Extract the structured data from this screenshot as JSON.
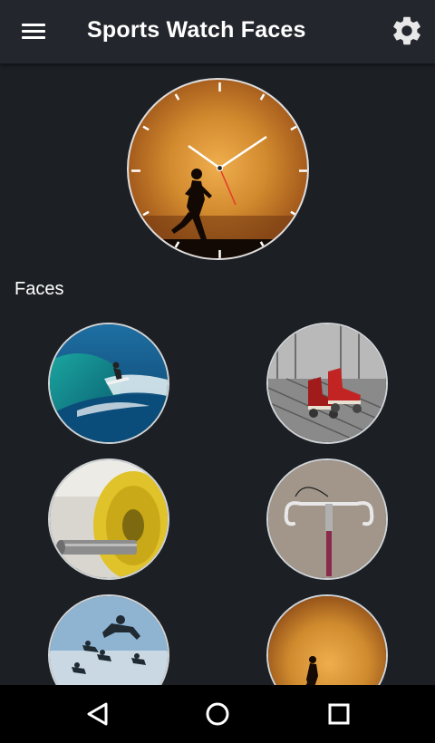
{
  "app": {
    "title": "Sports Watch Faces",
    "menu_icon": "hamburger-menu-icon",
    "settings_icon": "gear-icon"
  },
  "preview": {
    "description_icon": "watch-face-runner-sunset-preview"
  },
  "faces_section": {
    "label": "Faces",
    "items": [
      {
        "name": "surfer-face",
        "theme": "surfing"
      },
      {
        "name": "roller-skates-face",
        "theme": "roller-skating"
      },
      {
        "name": "weight-plate-face",
        "theme": "weightlifting"
      },
      {
        "name": "bicycle-handlebar-face",
        "theme": "cycling"
      },
      {
        "name": "skydivers-face",
        "theme": "skydiving"
      },
      {
        "name": "runner-sunset-face",
        "theme": "running"
      }
    ]
  },
  "navbar": {
    "back_icon": "back-triangle-icon",
    "home_icon": "home-circle-icon",
    "recents_icon": "recents-square-icon"
  },
  "colors": {
    "background": "#1c1f24",
    "appbar": "#23262c",
    "navbar": "#000000",
    "second_hand": "#e53a2a"
  }
}
